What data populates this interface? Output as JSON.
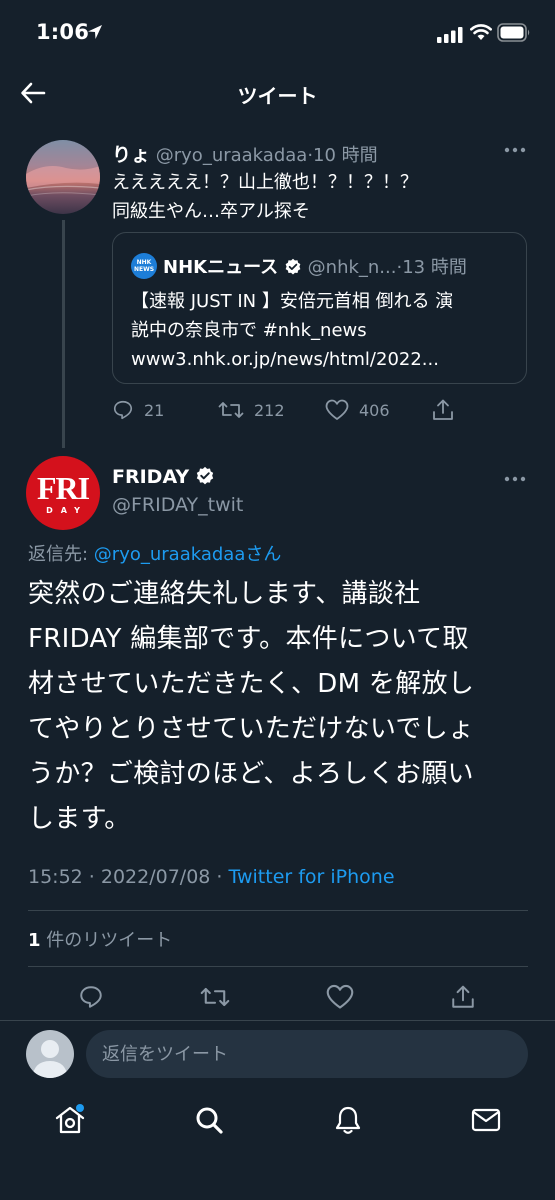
{
  "status_bar": {
    "time": "1:06"
  },
  "header": {
    "title": "ツイート"
  },
  "tweet1": {
    "name": "りょ",
    "handle": "@ryo_uraakadaa",
    "separator": "·",
    "time": "10 時間",
    "lines": [
      "えええええ！？山上徹也！？！？！？",
      "同級生やん…卒アル探そ"
    ],
    "quote": {
      "logo_text_top": "NHK",
      "logo_text_bottom": "NEWS",
      "name": "NHKニュース",
      "handle": "@nhk_n...",
      "separator": "·",
      "time": "13 時間",
      "lines": [
        "【速報 JUST IN 】安倍元首相 倒れる 演",
        "説中の奈良市で #nhk_news",
        "www3.nhk.or.jp/news/html/2022..."
      ]
    },
    "actions": {
      "replies": "21",
      "retweets": "212",
      "likes": "406"
    }
  },
  "tweet2": {
    "avatar_text_top": "FRI",
    "avatar_text_bottom": "DAY",
    "name": "FRIDAY",
    "handle": "@FRIDAY_twit",
    "reply_prefix": "返信先: ",
    "reply_handle": "@ryo_uraakadaa",
    "reply_suffix": "さん",
    "lines": [
      "突然のご連絡失礼します、講談社",
      "FRIDAY 編集部です。本件について取",
      "材させていただきたく、DM を解放し",
      "てやりとりさせていただけないでしょ",
      "うか？ご検討のほど、よろしくお願い",
      "します。"
    ],
    "timestamp": "15:52 · 2022/07/08 · ",
    "client": "Twitter for iPhone",
    "retweet_count": "1",
    "retweet_label": " 件のリツイート"
  },
  "reply_box": {
    "placeholder": "返信をツイート"
  },
  "colors": {
    "background": "#15202b",
    "accent": "#1d9bf0",
    "muted": "#8b98a5",
    "border": "#38444d"
  }
}
